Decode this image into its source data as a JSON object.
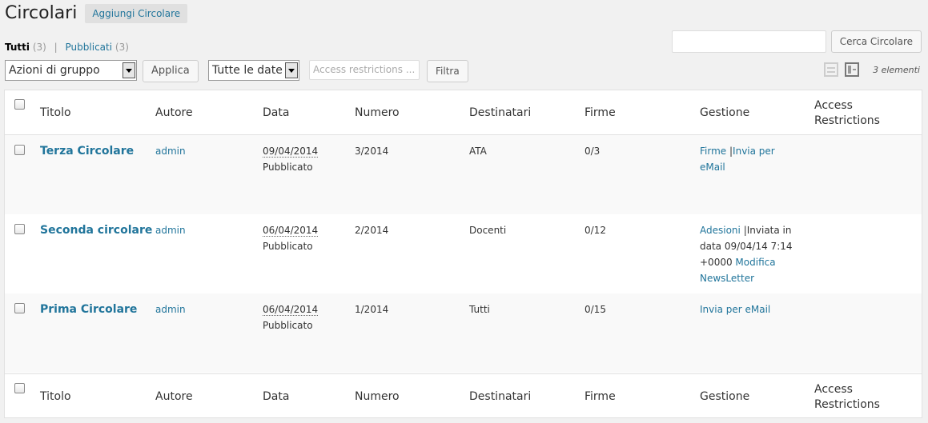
{
  "header": {
    "title": "Circolari",
    "add_new": "Aggiungi Circolare"
  },
  "filters": {
    "all_label": "Tutti",
    "all_count": "(3)",
    "separator": "|",
    "published_label": "Pubblicati",
    "published_count": "(3)"
  },
  "search": {
    "value": "",
    "button": "Cerca Circolare"
  },
  "tablenav": {
    "bulk_action": "Azioni di gruppo",
    "apply": "Applica",
    "date_filter": "Tutte le date",
    "access_placeholder": "Access restrictions ...",
    "filter": "Filtra",
    "items_count": "3 elementi"
  },
  "columns": {
    "title": "Titolo",
    "author": "Autore",
    "date": "Data",
    "number": "Numero",
    "recipients": "Destinatari",
    "signatures": "Firme",
    "management": "Gestione",
    "access_1": "Access",
    "access_2": "Restrictions"
  },
  "rows": [
    {
      "title": "Terza Circolare",
      "author": "admin",
      "date": "09/04/2014",
      "status": "Pubblicato",
      "number": "3/2014",
      "recipients": "ATA",
      "signatures": "0/3",
      "mgmt": {
        "link1": "Firme",
        "sep": "|",
        "link2a": "Invia per",
        "link2b": "eMail"
      }
    },
    {
      "title": "Seconda circolare",
      "author": "admin",
      "date": "06/04/2014",
      "status": "Pubblicato",
      "number": "2/2014",
      "recipients": "Docenti",
      "signatures": "0/12",
      "mgmt": {
        "link1": "Adesioni",
        "text1": "|Inviata in",
        "text2": "data 09/04/14 7:14",
        "text3": "+0000",
        "link2": "Modifica",
        "link3": "NewsLetter"
      }
    },
    {
      "title": "Prima Circolare",
      "author": "admin",
      "date": "06/04/2014",
      "status": "Pubblicato",
      "number": "1/2014",
      "recipients": "Tutti",
      "signatures": "0/15",
      "mgmt": {
        "link1": "Invia per eMail"
      }
    }
  ]
}
